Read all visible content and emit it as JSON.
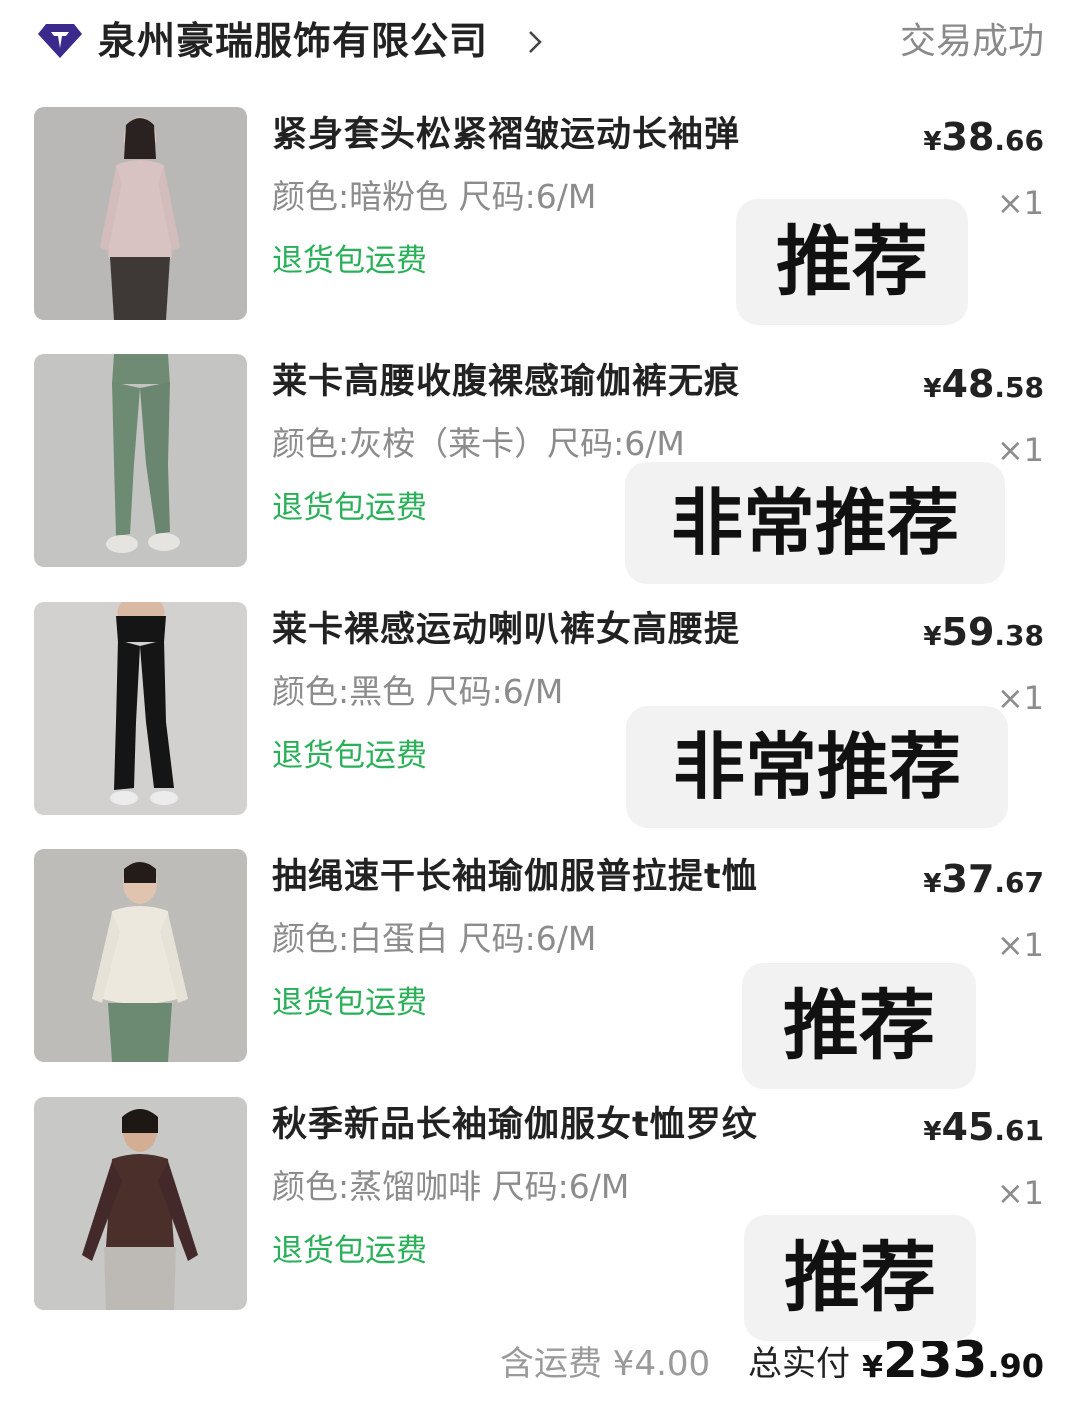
{
  "header": {
    "logo_icon": "diamond-shop-icon",
    "shop_name": "泉州豪瑞服饰有限公司",
    "chevron_icon": "chevron-right-icon",
    "status": "交易成功"
  },
  "items": [
    {
      "title": "紧身套头松紧褶皱运动长袖弹",
      "spec": "颜色:暗粉色 尺码:6/M",
      "return_tag": "退货包运费",
      "price_currency": "¥",
      "price_int": "38",
      "price_dec": ".66",
      "qty": "×1",
      "badge": "推荐",
      "thumb_icon": "pink-longsleeve-top-image"
    },
    {
      "title": "莱卡高腰收腹裸感瑜伽裤无痕",
      "spec": "颜色:灰桉（莱卡）尺码:6/M",
      "return_tag": "退货包运费",
      "price_currency": "¥",
      "price_int": "48",
      "price_dec": ".58",
      "qty": "×1",
      "badge": "非常推荐",
      "thumb_icon": "green-leggings-image"
    },
    {
      "title": "莱卡裸感运动喇叭裤女高腰提",
      "spec": "颜色:黑色 尺码:6/M",
      "return_tag": "退货包运费",
      "price_currency": "¥",
      "price_int": "59",
      "price_dec": ".38",
      "qty": "×1",
      "badge": "非常推荐",
      "thumb_icon": "black-flare-pants-image"
    },
    {
      "title": "抽绳速干长袖瑜伽服普拉提t恤",
      "spec": "颜色:白蛋白 尺码:6/M",
      "return_tag": "退货包运费",
      "price_currency": "¥",
      "price_int": "37",
      "price_dec": ".67",
      "qty": "×1",
      "badge": "推荐",
      "thumb_icon": "white-longsleeve-tee-image"
    },
    {
      "title": "秋季新品长袖瑜伽服女t恤罗纹",
      "spec": "颜色:蒸馏咖啡 尺码:6/M",
      "return_tag": "退货包运费",
      "price_currency": "¥",
      "price_int": "45",
      "price_dec": ".61",
      "qty": "×1",
      "badge": "推荐",
      "thumb_icon": "brown-ribbed-tee-image"
    }
  ],
  "footer": {
    "shipping": "含运费 ¥4.00",
    "total_label": "总实付",
    "total_currency": "¥",
    "total_int": "233",
    "total_dec": ".90"
  },
  "colors": {
    "return_tag": "#2bb05a",
    "logo": "#3b2a8c",
    "status": "#8a8a8a",
    "badge_bg": "#f2f2f2"
  }
}
